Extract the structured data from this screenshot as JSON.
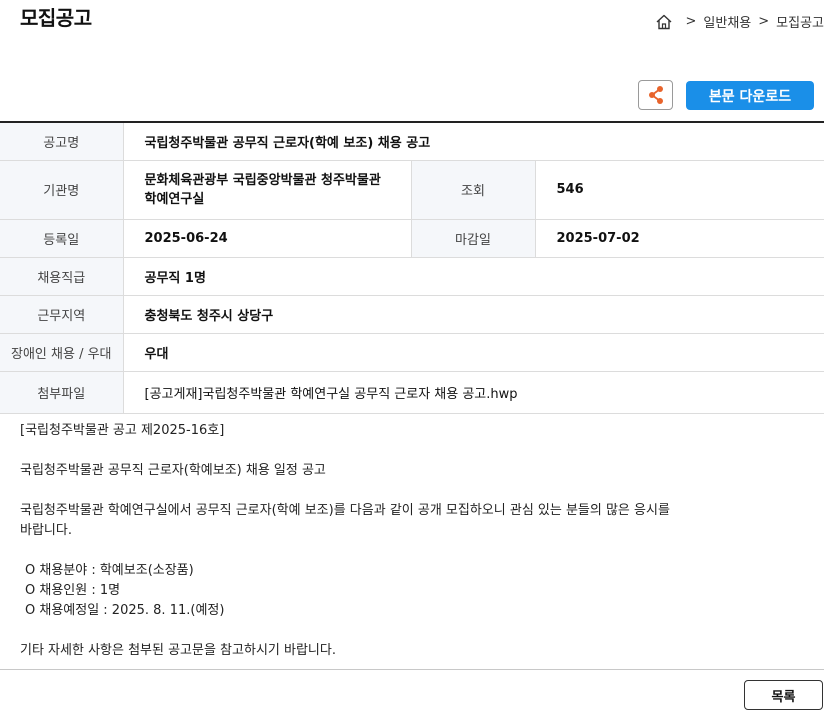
{
  "header": {
    "title": "모집공고",
    "breadcrumb": [
      "일반채용",
      "모집공고"
    ],
    "home_icon": "home-icon"
  },
  "toolbar": {
    "share_icon": "share-icon",
    "download_label": "본문 다운로드"
  },
  "table": {
    "notice_label": "공고명",
    "notice_value": "국립청주박물관 공무직 근로자(학예 보조) 채용 공고",
    "org_label": "기관명",
    "org_value_line1": "문화체육관광부 국립중앙박물관 청주박물관",
    "org_value_line2": "학예연구실",
    "views_label": "조회",
    "views_value": "546",
    "reg_label": "등록일",
    "reg_value": "2025-06-24",
    "deadline_label": "마감일",
    "deadline_value": "2025-07-02",
    "grade_label": "채용직급",
    "grade_value": "공무직 1명",
    "region_label": "근무지역",
    "region_value": "충청북도 청주시 상당구",
    "disabled_label": "장애인 채용 / 우대",
    "disabled_value": "우대",
    "attach_label": "첨부파일",
    "attach_value": "[공고게재]국립청주박물관 학예연구실 공무직 근로자 채용 공고.hwp"
  },
  "body": {
    "line1": "[국립청주박물관 공고 제2025-16호]",
    "line2": "국립청주박물관 공무직 근로자(학예보조) 채용 일정 공고",
    "line3": "국립청주박물관 학예연구실에서 공무직 근로자(학예 보조)를 다음과 같이 공개 모집하오니 관심 있는 분들의 많은 응시를",
    "line4": "바랍니다.",
    "item1": "O 채용분야 : 학예보조(소장품)",
    "item2": "O 채용인원 : 1명",
    "item3": "O 채용예정일 : 2025. 8. 11.(예정)",
    "closing": "기타 자세한 사항은 첨부된 공고문을 참고하시기 바랍니다."
  },
  "footer": {
    "list_label": "목록"
  },
  "colors": {
    "accent": "#1a8fe8",
    "share_orange": "#e8642c",
    "header_cell_bg": "#f5f7fa"
  }
}
